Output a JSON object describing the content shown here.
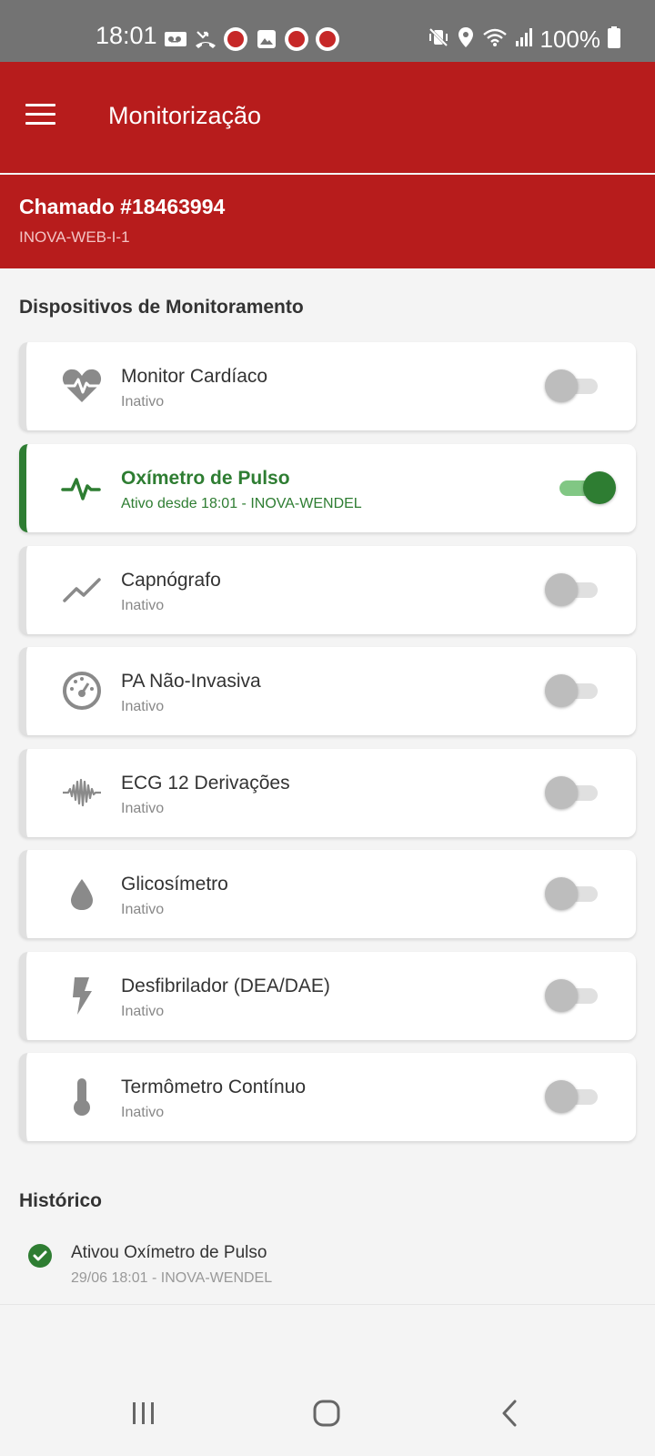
{
  "status_bar": {
    "time": "18:01",
    "battery": "100%",
    "icons_left": [
      "voicemail-icon",
      "missed-call-icon",
      "app-notification-icon",
      "gallery-icon",
      "app-notification-icon",
      "app-notification-icon"
    ],
    "icons_right": [
      "vibrate-icon",
      "location-icon",
      "wifi-icon",
      "signal-icon",
      "battery-icon"
    ]
  },
  "appbar": {
    "title": "Monitorização",
    "menu_icon": "hamburger-menu-icon"
  },
  "call": {
    "title": "Chamado #18463994",
    "subtitle": "INOVA-WEB-I-1"
  },
  "devices_section": {
    "title": "Dispositivos de Monitoramento"
  },
  "devices": [
    {
      "name": "Monitor Cardíaco",
      "status": "Inativo",
      "icon": "heart-pulse-icon",
      "active": false
    },
    {
      "name": "Oxímetro de Pulso",
      "status": "Ativo desde 18:01 - INOVA-WENDEL",
      "icon": "pulse-wave-icon",
      "active": true
    },
    {
      "name": "Capnógrafo",
      "status": "Inativo",
      "icon": "trend-line-icon",
      "active": false
    },
    {
      "name": "PA Não-Invasiva",
      "status": "Inativo",
      "icon": "gauge-icon",
      "active": false
    },
    {
      "name": "ECG 12 Derivações",
      "status": "Inativo",
      "icon": "waveform-icon",
      "active": false
    },
    {
      "name": "Glicosímetro",
      "status": "Inativo",
      "icon": "drop-icon",
      "active": false
    },
    {
      "name": "Desfibrilador (DEA/DAE)",
      "status": "Inativo",
      "icon": "lightning-icon",
      "active": false
    },
    {
      "name": "Termômetro Contínuo",
      "status": "Inativo",
      "icon": "thermometer-icon",
      "active": false
    }
  ],
  "history_section": {
    "title": "Histórico"
  },
  "history": [
    {
      "title": "Ativou Oxímetro de Pulso",
      "subtitle": "29/06 18:01 - INOVA-WENDEL",
      "icon": "check-circle-icon"
    }
  ],
  "colors": {
    "primary": "#b71c1c",
    "active": "#2e7d32",
    "statusbar": "#737373",
    "background": "#f4f4f4"
  },
  "nav": {
    "buttons": [
      "recents-icon",
      "home-icon",
      "back-icon"
    ]
  }
}
